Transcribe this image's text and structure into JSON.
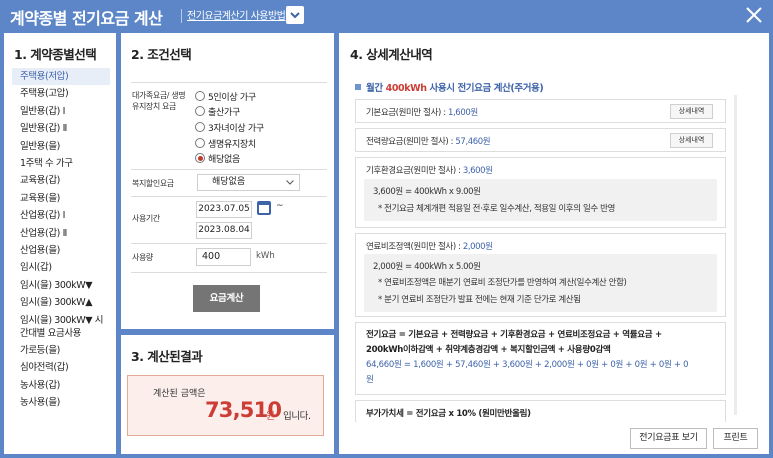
{
  "header": {
    "title": "계약종별 전기요금 계산",
    "help_link": "전기요금계산기 사용방법"
  },
  "section1": {
    "title": "1. 계약종별선택",
    "items": [
      "주택용(저압)",
      "주택용(고압)",
      "일반용(갑) Ⅰ",
      "일반용(갑) Ⅱ",
      "일반용(을)",
      "1주택 수 가구",
      "교육용(갑)",
      "교육용(을)",
      "산업용(갑) Ⅰ",
      "산업용(갑) Ⅱ",
      "산업용(을)",
      "임시(갑)",
      "임시(을) 300kW▼",
      "임시(을) 300kW▲",
      "임시(을) 300kW▼ 시간대별 요금사용",
      "가로등(을)",
      "심야전력(갑)",
      "농사용(갑)",
      "농사용(을)"
    ],
    "selected_index": 0
  },
  "section2": {
    "title": "2. 조건선택",
    "welfare_label": "대가족요금/ 생명유지장치 요금",
    "radio_options": [
      "5인이상 가구",
      "출산가구",
      "3자녀이상 가구",
      "생명유지장치",
      "해당없음"
    ],
    "radio_selected": "해당없음",
    "discount_label": "복지할인요금",
    "discount_value": "해당없음",
    "period_label": "사용기간",
    "date_start": "2023.07.05",
    "date_end": "2023.08.04",
    "date_sep": "~",
    "usage_label": "사용량",
    "usage_value": "400",
    "usage_unit": "kWh",
    "calc_button": "요금계산"
  },
  "section3": {
    "title": "3. 계산된결과",
    "label": "계산된 금액은",
    "amount": "73,510",
    "unit": "원",
    "tail": "입니다."
  },
  "section4": {
    "title": "4. 상세계산내역",
    "monthly_pre": "월간",
    "monthly_kwh": "400kWh",
    "monthly_post": "사용시 전기요금 계산(주거용)",
    "base_label": "기본요금(원미만 절사) :",
    "base_value": "1,600원",
    "base_btn": "상세내역",
    "energy_label": "전력량요금(원미만 절사) :",
    "energy_value": "57,460원",
    "energy_btn": "상세내역",
    "climate_label": "기후환경요금(원미만 절사) :",
    "climate_value": "3,600원",
    "climate_line1": "3,600원 = 400kWh x 9.00원",
    "climate_line2": "* 전기요금 체계개편 적용일 전·후로 일수계산, 적용일 이후의 일수 반영",
    "fuel_label": "연료비조정액(원미만 절사) :",
    "fuel_value": "2,000원",
    "fuel_line1": "2,000원 = 400kWh x 5.00원",
    "fuel_line2": "* 연료비조정액은 매분기 연료비 조정단가를 반영하여 계산(일수계산 안함)",
    "fuel_line3": "* 분기 연료비 조정단가 발표 전에는 현재 기준 단가로 계산됨",
    "total_line1": "전기요금 = 기본요금 + 전력량요금 + 기후환경요금 + 연료비조정요금 + 역률요금 +",
    "total_line2": "200kWh이하감액 + 취약계층경감액 + 복지할인금액 + 사용량0감액",
    "total_values1": "64,660원 = 1,600원 + 57,460원 + 3,600원 + 2,000원 + 0원 + 0원 + 0원 + 0원 + 0",
    "total_values2": "원",
    "vat_line": "부가가치세 = 전기요금 x 10% (원미만반올림)",
    "table_btn": "전기요금표 보기",
    "print_btn": "프린트"
  },
  "colors": {
    "header_bg": "#5c86c8",
    "accent_blue": "#3d63a8",
    "accent_red": "#cc3d35"
  }
}
